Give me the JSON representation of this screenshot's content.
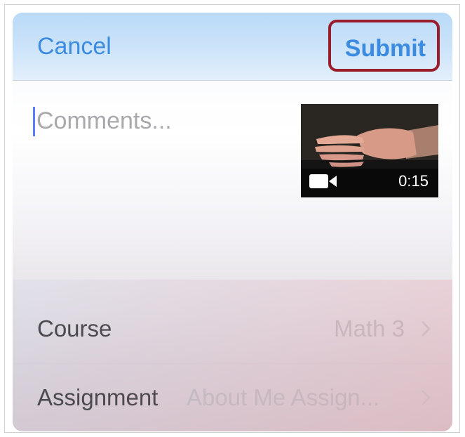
{
  "navbar": {
    "cancel_label": "Cancel",
    "submit_label": "Submit"
  },
  "comment": {
    "placeholder": "Comments...",
    "value": ""
  },
  "attachment": {
    "duration": "0:15",
    "icon": "video-camera-icon"
  },
  "rows": [
    {
      "label": "Course",
      "value": "Math 3",
      "icon": "chevron-right-icon"
    },
    {
      "label": "Assignment",
      "value": "About Me Assign...",
      "icon": "chevron-right-icon"
    }
  ],
  "colors": {
    "accent": "#3b8be0",
    "highlight_border": "#9a1d2b",
    "secondary_text": "#bdb8bd"
  }
}
